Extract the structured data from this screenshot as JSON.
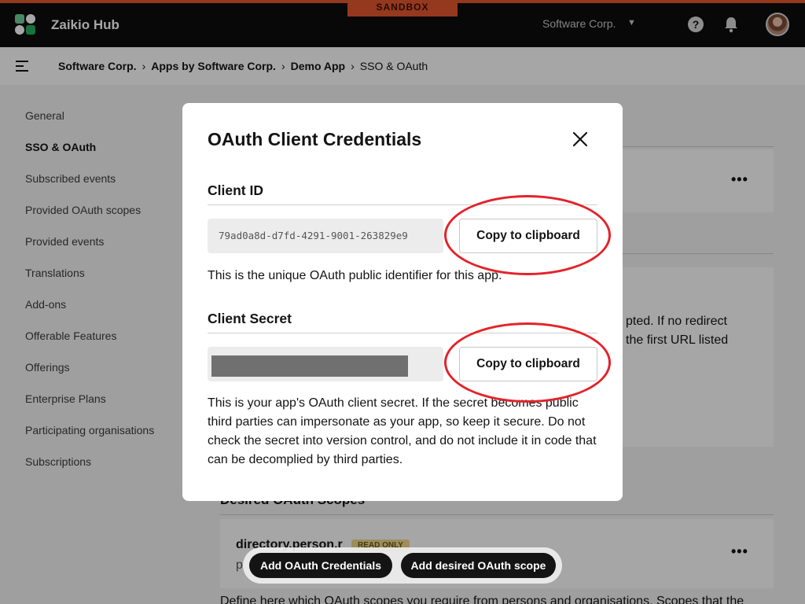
{
  "header": {
    "app_title": "Zaikio Hub",
    "environment_badge": "SANDBOX",
    "org_switcher": "Software Corp.",
    "help_label": "?"
  },
  "breadcrumb": {
    "items": [
      "Software Corp.",
      "Apps by Software Corp.",
      "Demo App"
    ],
    "current": "SSO & OAuth",
    "separator": "›"
  },
  "sidebar": {
    "items": [
      {
        "label": "General"
      },
      {
        "label": "SSO & OAuth",
        "active": true
      },
      {
        "label": "Subscribed events"
      },
      {
        "label": "Provided OAuth scopes"
      },
      {
        "label": "Provided events"
      },
      {
        "label": "Translations"
      },
      {
        "label": "Add-ons"
      },
      {
        "label": "Offerable Features"
      },
      {
        "label": "Offerings"
      },
      {
        "label": "Enterprise Plans"
      },
      {
        "label": "Participating organisations"
      },
      {
        "label": "Subscriptions"
      }
    ]
  },
  "background": {
    "redirect_text_1": "pted. If no redirect",
    "redirect_text_2": "the first URL listed",
    "scopes_heading": "Desired OAuth Scopes",
    "scope_name": "directory.person.r",
    "scope_badge": "READ ONLY",
    "scope_sub": "p",
    "scopes_description": "Define here which OAuth scopes you require from persons and organisations. Scopes that the"
  },
  "actions": {
    "add_credentials": "Add OAuth Credentials",
    "add_scope": "Add desired OAuth scope"
  },
  "modal": {
    "title": "OAuth Client Credentials",
    "client_id": {
      "label": "Client ID",
      "value": "79ad0a8d-d7fd-4291-9001-263829e9",
      "copy_label": "Copy to clipboard",
      "help": "This is the unique OAuth public identifier for this app."
    },
    "client_secret": {
      "label": "Client Secret",
      "copy_label": "Copy to clipboard",
      "help": "This is your app's OAuth client secret. If the secret becomes public third parties can impersonate as your app, so keep it secure. Do not check the secret into version control, and do not include it in code that can be decomplied by third parties."
    }
  },
  "colors": {
    "brand_accent": "#e4572e",
    "topbar": "#0d0d0d",
    "annotation_ring": "#e3232a"
  }
}
